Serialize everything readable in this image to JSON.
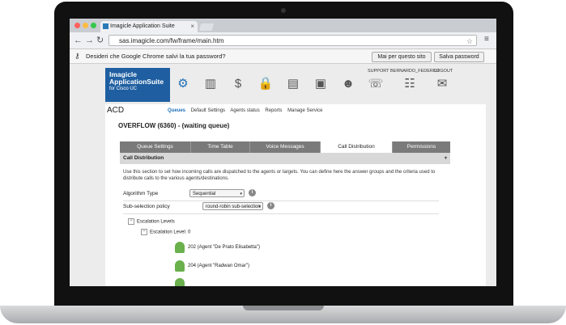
{
  "browser": {
    "tab_title": "Imagicle Application Suite",
    "url": "sas.imagicle.com/fw/frame/main.htm",
    "password_prompt": "Desideri che Google Chrome salvi la tua password?",
    "never_button": "Mai per questo sito",
    "save_button": "Salva password"
  },
  "app": {
    "brand_line1": "Imagicle",
    "brand_line2": "ApplicationSuite",
    "brand_line3": "for Cisco UC",
    "links": {
      "support": "SUPPORT",
      "user": "BERNARDO_FEDERIGI",
      "logout": "LOGOUT"
    },
    "page_title": "ACD",
    "subnav": [
      "Queues",
      "Default Settings",
      "Agents status",
      "Reports",
      "Manage Service"
    ],
    "queue_title": "OVERFLOW (6360) - (waiting queue)",
    "tabs": [
      "Queue Settings",
      "Time Table",
      "Voice Messages",
      "Call Distribution",
      "Permissions"
    ],
    "panel_title": "Call Distribution",
    "description": "Use this section to set how incoming calls are dispatched to the agents or targets. You can define here the answer groups and the criteria used to distribute calls to the various agents/destinations.",
    "algorithm_label": "Algorithm Type",
    "algorithm_value": "Sequential",
    "subselection_label": "Sub-selection policy",
    "subselection_value": "round-robin sub-selection",
    "escalation_levels": "Escalation Levels",
    "escalation_level": "Escalation Level: 0",
    "agents": [
      "202 (Agent \"De Prato Elisabetta\")",
      "204 (Agent \"Radwan Omar\")"
    ]
  },
  "colors": {
    "accent": "#1f6fb8",
    "brand": "#1f5fa1",
    "agent_icon": "#6ab04c"
  }
}
